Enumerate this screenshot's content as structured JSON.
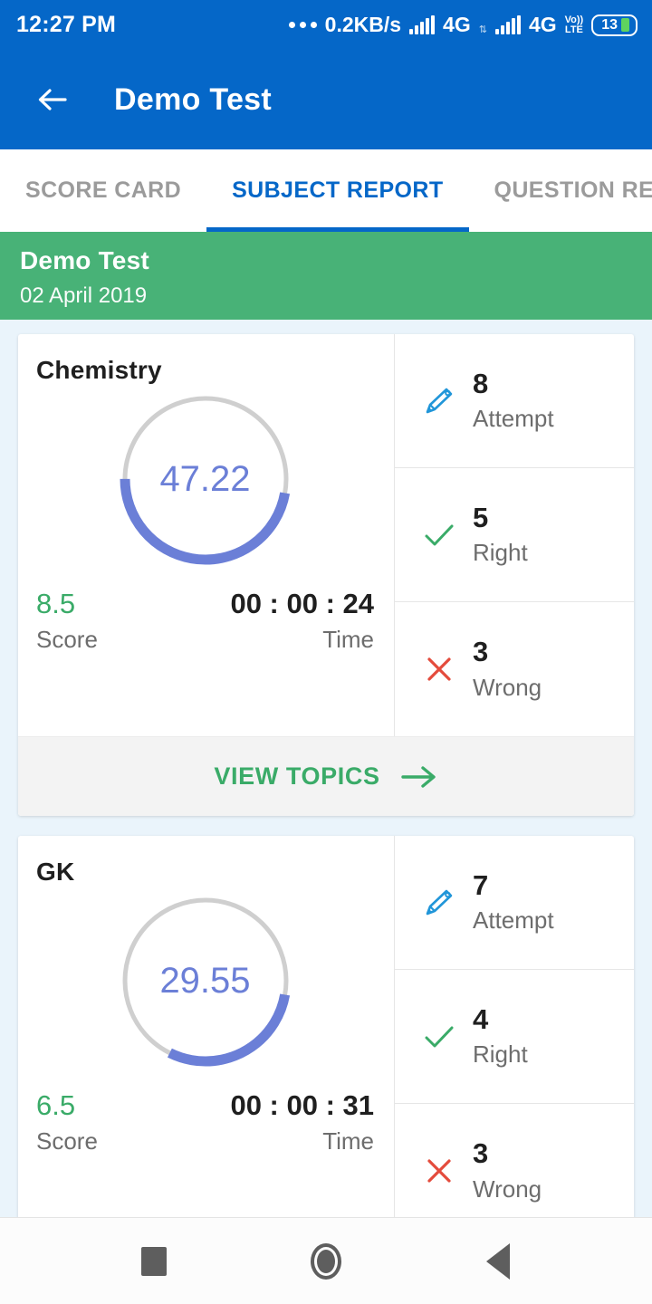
{
  "status_bar": {
    "time": "12:27 PM",
    "net_speed": "0.2KB/s",
    "network_1": "4G",
    "network_2": "4G",
    "volte_top": "Vo))",
    "volte_bottom": "LTE",
    "battery": "13",
    "overflow_icon": "more-dots-icon"
  },
  "app_bar": {
    "back_icon": "back-arrow-icon",
    "title": "Demo Test",
    "background": "#0567c8"
  },
  "tabs": {
    "items": [
      {
        "label": "SCORE CARD",
        "active": false
      },
      {
        "label": "SUBJECT REPORT",
        "active": true
      },
      {
        "label": "QUESTION REPORT",
        "active": false
      }
    ],
    "active_color": "#0567c8",
    "inactive_color": "#9b9b9b"
  },
  "banner": {
    "title": "Demo Test",
    "date": "02 April 2019",
    "background": "#48b277"
  },
  "cards": [
    {
      "subject": "Chemistry",
      "percent": "47.22",
      "percent_value": 47.22,
      "ring_color": "#6b7fd7",
      "track_color": "#cfcfcf",
      "score": "8.5",
      "score_label": "Score",
      "time": "00 : 00 : 24",
      "time_label": "Time",
      "stats": [
        {
          "icon": "pencil-icon",
          "value": "8",
          "label": "Attempt",
          "color": "#2196d9"
        },
        {
          "icon": "check-icon",
          "value": "5",
          "label": "Right",
          "color": "#3aab68"
        },
        {
          "icon": "cross-icon",
          "value": "3",
          "label": "Wrong",
          "color": "#e44b3c"
        }
      ],
      "action": {
        "label": "VIEW TOPICS",
        "icon": "arrow-right-icon",
        "color": "#3aab68"
      }
    },
    {
      "subject": "GK",
      "percent": "29.55",
      "percent_value": 29.55,
      "ring_color": "#6b7fd7",
      "track_color": "#cfcfcf",
      "score": "6.5",
      "score_label": "Score",
      "time": "00 : 00 : 31",
      "time_label": "Time",
      "stats": [
        {
          "icon": "pencil-icon",
          "value": "7",
          "label": "Attempt",
          "color": "#2196d9"
        },
        {
          "icon": "check-icon",
          "value": "4",
          "label": "Right",
          "color": "#3aab68"
        },
        {
          "icon": "cross-icon",
          "value": "3",
          "label": "Wrong",
          "color": "#e44b3c"
        }
      ],
      "action": null
    }
  ],
  "nav_bar": {
    "recents_icon": "square-icon",
    "home_icon": "circle-icon",
    "back_icon": "triangle-back-icon"
  }
}
